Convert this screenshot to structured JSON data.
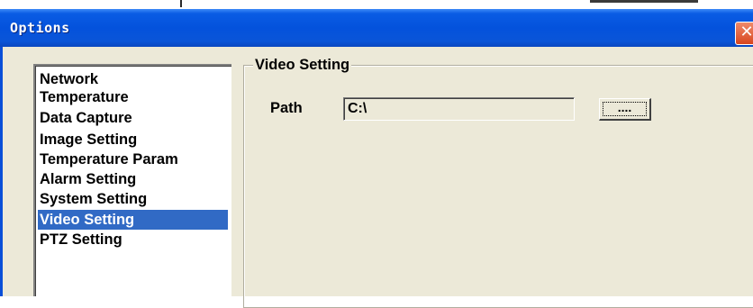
{
  "window": {
    "title": "Options",
    "close_glyph": "✕"
  },
  "sidebar": {
    "items": [
      {
        "label": "Network",
        "selected": false
      },
      {
        "label": "Temperature",
        "selected": false
      },
      {
        "label": "Data Capture",
        "selected": false
      },
      {
        "label": "Image Setting",
        "selected": false
      },
      {
        "label": "Temperature Param",
        "selected": false
      },
      {
        "label": "Alarm Setting",
        "selected": false
      },
      {
        "label": "System Setting",
        "selected": false
      },
      {
        "label": "Video Setting",
        "selected": true
      },
      {
        "label": "PTZ Setting",
        "selected": false
      }
    ]
  },
  "panel": {
    "group_title": "Video Setting",
    "path_label": "Path",
    "path_value": "C:\\",
    "browse_label": "...."
  },
  "colors": {
    "titlebar": "#0452dc",
    "selection": "#316ac5",
    "dialog_bg": "#ece9d8",
    "close_button": "#d8461f"
  }
}
